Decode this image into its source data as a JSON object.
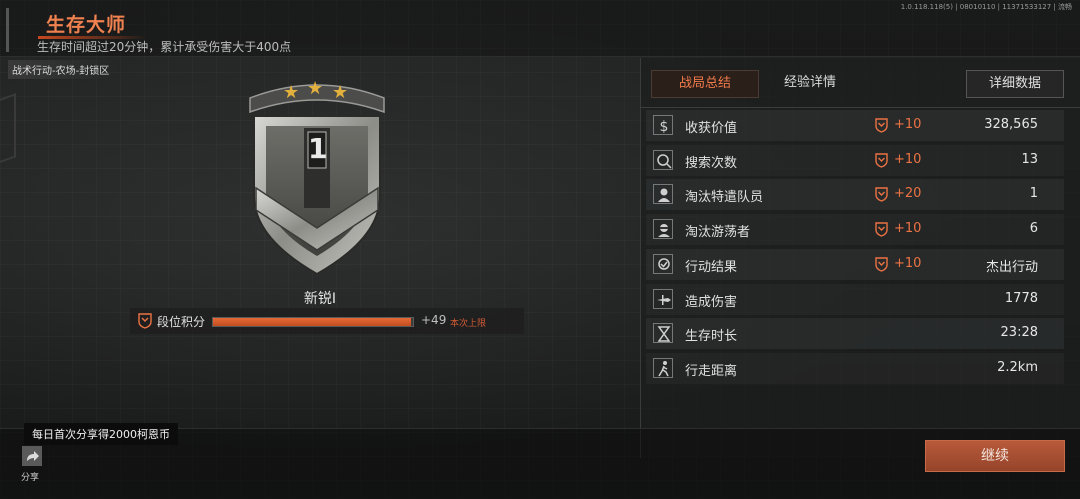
{
  "version_text": "1.0.118.118(5) | 08010110 | 11371533127 | 流畅",
  "header": {
    "title": "生存大师",
    "subtitle": "生存时间超过20分钟，累计承受伤害大于400点",
    "location": "战术行动-农场-封锁区"
  },
  "rank": {
    "badge_number": "1",
    "stars": 3,
    "name": "新锐I",
    "points_label": "段位积分",
    "progress": 0.99,
    "gain": "+49",
    "cap_note": "本次上限"
  },
  "tabs": {
    "summary": "战局总结",
    "experience": "经验详情",
    "detail": "详细数据"
  },
  "stats": [
    {
      "icon": "dollar-icon",
      "label": "收获价值",
      "bonus": "+10",
      "value": "328,565"
    },
    {
      "icon": "search-icon",
      "label": "搜索次数",
      "bonus": "+10",
      "value": "13"
    },
    {
      "icon": "operator-icon",
      "label": "淘汰特遣队员",
      "bonus": "+20",
      "value": "1"
    },
    {
      "icon": "bandit-icon",
      "label": "淘汰游荡者",
      "bonus": "+10",
      "value": "6"
    },
    {
      "icon": "result-icon",
      "label": "行动结果",
      "bonus": "+10",
      "value": "杰出行动"
    },
    {
      "icon": "damage-icon",
      "label": "造成伤害",
      "bonus": "",
      "value": "1778"
    },
    {
      "icon": "hourglass-icon",
      "label": "生存时长",
      "bonus": "",
      "value": "23:28"
    },
    {
      "icon": "walking-icon",
      "label": "行走距离",
      "bonus": "",
      "value": "2.2km"
    }
  ],
  "footer": {
    "share_tip": "每日首次分享得2000柯恩币",
    "share_label": "分享",
    "continue_label": "继续"
  },
  "colors": {
    "accent": "#ec7344",
    "button": "#a34d30"
  }
}
